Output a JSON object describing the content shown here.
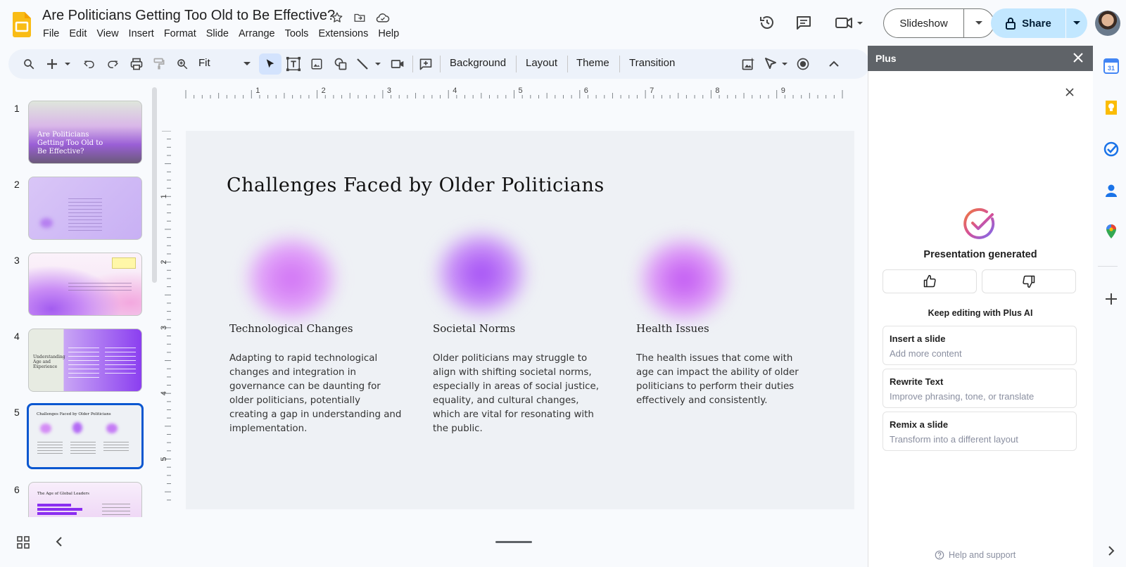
{
  "app": {
    "title": "Are Politicians Getting Too Old to Be Effective?",
    "menu": [
      "File",
      "Edit",
      "View",
      "Insert",
      "Format",
      "Slide",
      "Arrange",
      "Tools",
      "Extensions",
      "Help"
    ],
    "slideshow_label": "Slideshow",
    "share_label": "Share"
  },
  "toolbar": {
    "zoom_value": "Fit",
    "background_label": "Background",
    "layout_label": "Layout",
    "theme_label": "Theme",
    "transition_label": "Transition"
  },
  "filmstrip": {
    "slides": [
      {
        "number": "1",
        "title": "Are Politicians Getting Too Old to Be Effective?"
      },
      {
        "number": "2",
        "title": "Agenda"
      },
      {
        "number": "3",
        "title": "Introduction"
      },
      {
        "number": "4",
        "title": "Understanding Age and Experience"
      },
      {
        "number": "5",
        "title": "Challenges Faced by Older Politicians"
      },
      {
        "number": "6",
        "title": "The Age of Global Leaders"
      }
    ],
    "selected": "5"
  },
  "ruler": {
    "top_marks": [
      "1",
      "2",
      "3",
      "4",
      "5",
      "6",
      "7",
      "8",
      "9"
    ],
    "left_marks": [
      "1",
      "2",
      "3",
      "4",
      "5"
    ]
  },
  "slide": {
    "title": "Challenges Faced by Older Politicians",
    "columns": [
      {
        "heading": "Technological Changes",
        "body": "Adapting to rapid technological changes and integration in governance can be daunting for older politicians, potentially creating a gap in understanding and implementation."
      },
      {
        "heading": "Societal Norms",
        "body": "Older politicians may struggle to align with shifting societal norms, especially in areas of social justice, equality, and cultural changes, which are vital for resonating with the public."
      },
      {
        "heading": "Health Issues",
        "body": "The health issues that come with age can impact the ability of older politicians to perform their duties effectively and consistently."
      }
    ]
  },
  "panel": {
    "header_title": "Plus",
    "status": "Presentation generated",
    "keep_editing": "Keep editing with Plus AI",
    "actions": [
      {
        "title": "Insert a slide",
        "subtitle": "Add more content"
      },
      {
        "title": "Rewrite Text",
        "subtitle": "Improve phrasing, tone, or translate"
      },
      {
        "title": "Remix a slide",
        "subtitle": "Transform into a different layout"
      }
    ],
    "help": "Help and support"
  },
  "colors": {
    "accent": "#0b57d0",
    "share_bg": "#c2e7ff",
    "toolbar_bg": "#edf2fa",
    "panel_header": "#5f6368"
  },
  "icons": [
    "slides-logo",
    "star-icon",
    "move-folder-icon",
    "cloud-saved-icon",
    "history-icon",
    "comments-icon",
    "meet-icon",
    "lock-icon",
    "search-icon",
    "plus-icon",
    "undo-icon",
    "redo-icon",
    "print-icon",
    "paint-format-icon",
    "zoom-icon",
    "select-icon",
    "textbox-icon",
    "image-icon",
    "shape-icon",
    "line-icon",
    "video-icon",
    "comment-add-icon",
    "thumbs-up-icon",
    "thumbs-down-icon",
    "help-icon"
  ]
}
